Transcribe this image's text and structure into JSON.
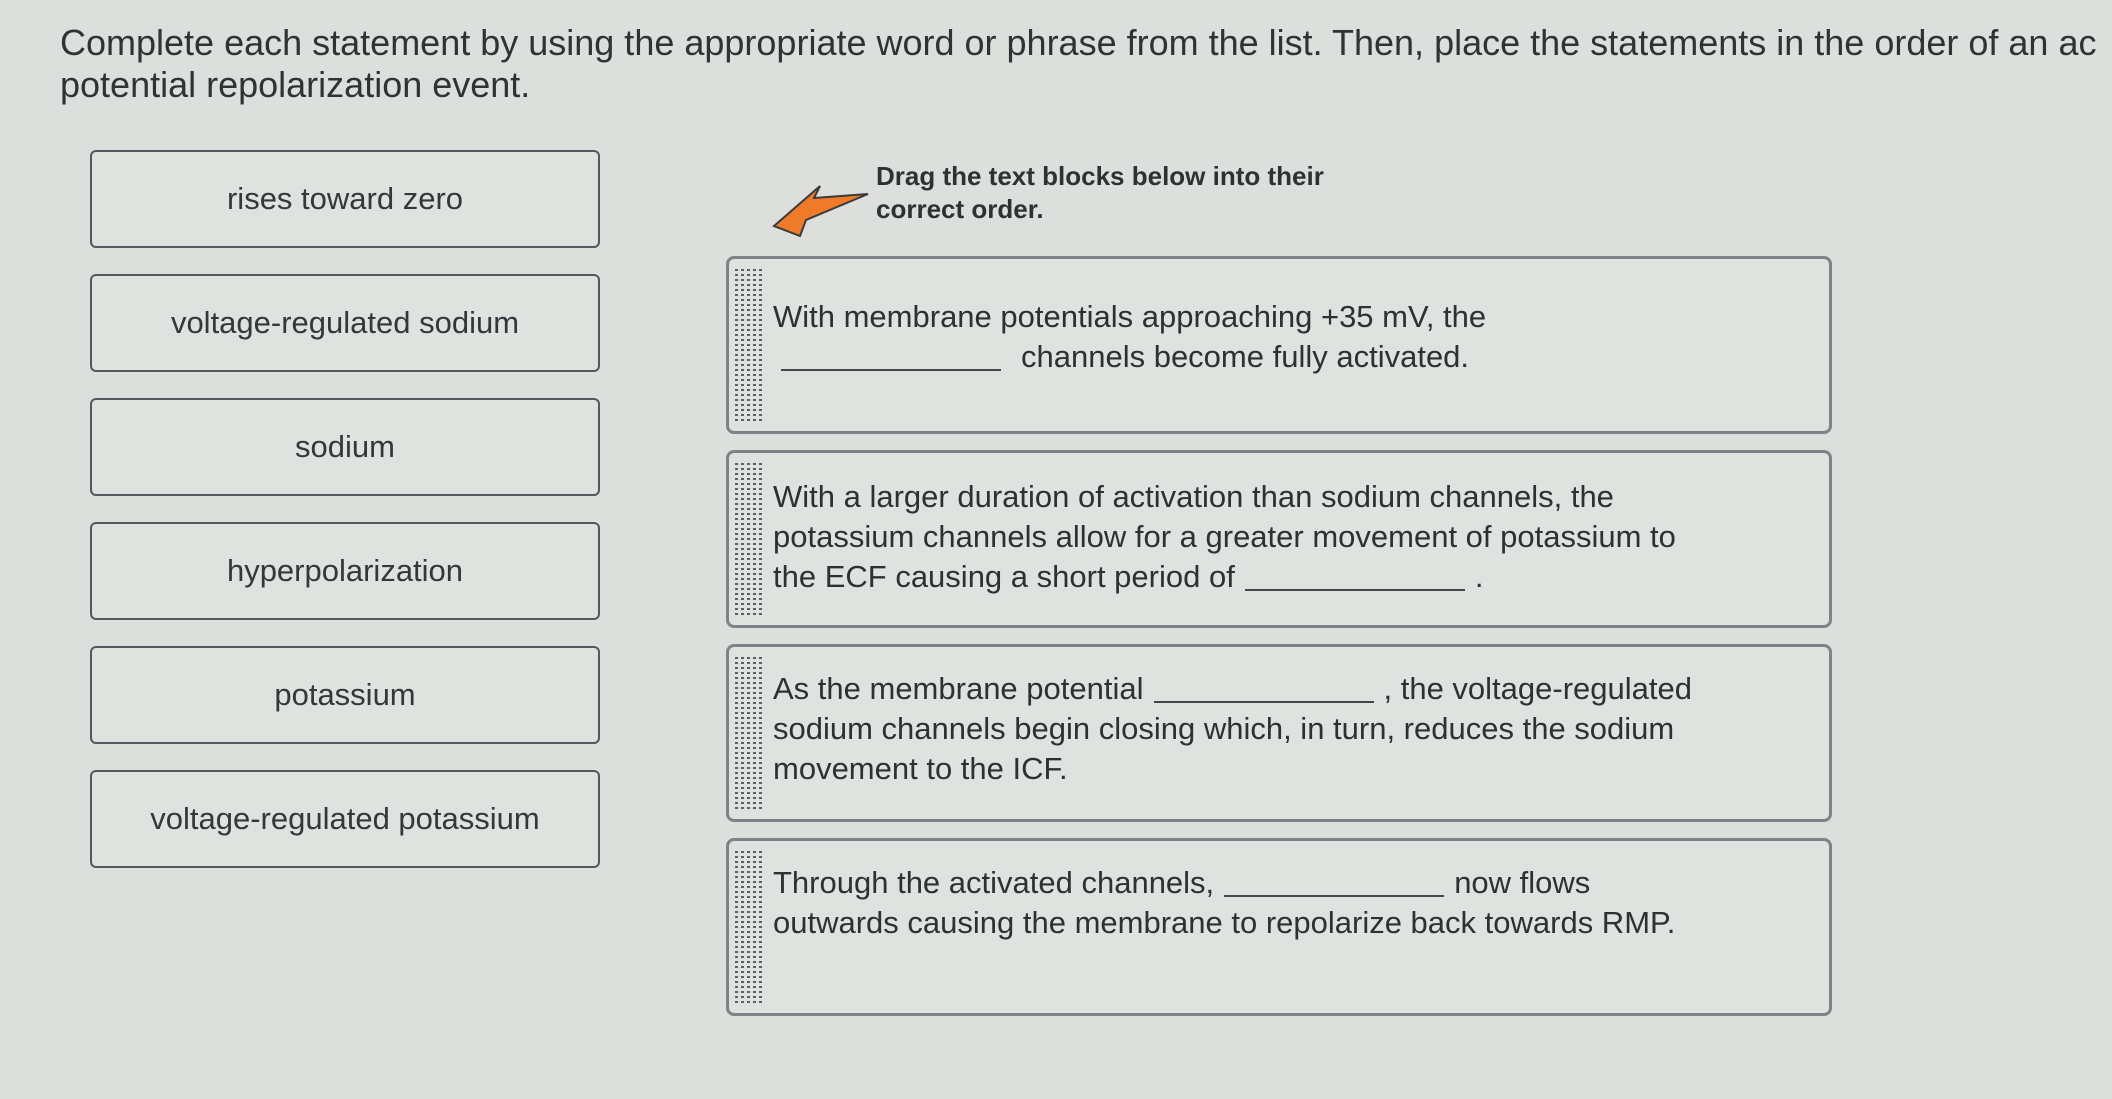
{
  "instructions": "Complete each statement by using the appropriate word or phrase from the list. Then, place the statements in the order of an ac potential repolarization event.",
  "word_bank": [
    "rises toward zero",
    "voltage-regulated sodium",
    "sodium",
    "hyperpolarization",
    "potassium",
    "voltage-regulated potassium"
  ],
  "drag_hint": {
    "icon": "arrow-icon",
    "text": "Drag the text blocks below into their correct order."
  },
  "statements": [
    {
      "part1": "With membrane potentials approaching +35 mV, the",
      "part2": "channels become fully activated."
    },
    {
      "part1": "With a larger duration of activation than sodium channels, the potassium channels allow for a greater movement of potassium to the ECF causing a short period of",
      "part2": "."
    },
    {
      "part1": "As the membrane potential",
      "part2": ", the voltage-regulated sodium channels begin closing which, in turn, reduces the sodium movement to the ICF."
    },
    {
      "part1": "Through the activated channels,",
      "part2": "now flows outwards causing the membrane to repolarize back towards RMP."
    }
  ],
  "colors": {
    "arrow": "#ee7a2a",
    "border": "#55595e"
  }
}
